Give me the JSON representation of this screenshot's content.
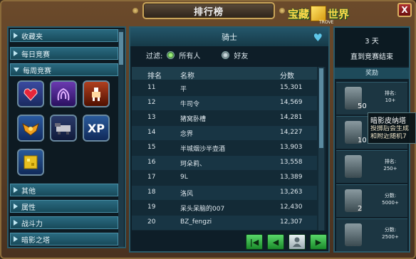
{
  "window": {
    "title": "排行榜",
    "logo_text_left": "宝藏",
    "logo_text_right": "世界",
    "logo_sub": "TROVE",
    "close_label": "X"
  },
  "sidebar": {
    "items": [
      {
        "label": "收藏夹",
        "expanded": false
      },
      {
        "label": "每日竞赛",
        "expanded": false
      },
      {
        "label": "每周竞赛",
        "expanded": true
      },
      {
        "label": "其他",
        "expanded": false
      },
      {
        "label": "属性",
        "expanded": false
      },
      {
        "label": "战斗力",
        "expanded": false
      },
      {
        "label": "暗影之塔",
        "expanded": false
      }
    ],
    "weekly_icons": [
      "heart-gem-icon",
      "tentacle-icon",
      "fighter-icon",
      "wings-badge-icon",
      "mount-icon",
      "xp-icon",
      "block-cube-icon"
    ],
    "xp_label": "XP"
  },
  "board": {
    "header": "骑士",
    "filter_label": "过滤:",
    "filter_all": "所有人",
    "filter_friends": "好友",
    "columns": [
      "排名",
      "名称",
      "分数"
    ],
    "rows": [
      {
        "rank": "11",
        "name": "平",
        "score": "15,301"
      },
      {
        "rank": "12",
        "name": "牛司令",
        "score": "14,569"
      },
      {
        "rank": "13",
        "name": "猪窝卧槽",
        "score": "14,281"
      },
      {
        "rank": "14",
        "name": "念界",
        "score": "14,227"
      },
      {
        "rank": "15",
        "name": "半城烟沙半壶酒",
        "score": "13,903"
      },
      {
        "rank": "16",
        "name": "珂朵莉、",
        "score": "13,558"
      },
      {
        "rank": "17",
        "name": "9L",
        "score": "13,389"
      },
      {
        "rank": "18",
        "name": "洛风",
        "score": "13,263"
      },
      {
        "rank": "19",
        "name": "呆头呆脑的007",
        "score": "12,430"
      },
      {
        "rank": "20",
        "name": "BZ_fengzi",
        "score": "12,307"
      }
    ]
  },
  "contest": {
    "days": "3 天",
    "until": "直到竞赛结束",
    "rewards_header": "奖励",
    "rewards": [
      {
        "qty": "50",
        "line1": "排名:",
        "line2": "10+"
      },
      {
        "qty": "10",
        "line1": "",
        "line2": ""
      },
      {
        "qty": "",
        "line1": "排名:",
        "line2": "250+"
      },
      {
        "qty": "2",
        "line1": "分数:",
        "line2": "5000+"
      },
      {
        "qty": "",
        "line1": "分数:",
        "line2": "2500+"
      }
    ]
  },
  "tooltip": {
    "title": "暗影皮纳塔",
    "line1": "投掷后会生成",
    "line2": "和附近随机7"
  },
  "colors": {
    "accent": "#2a6a80",
    "frame": "#6b4a2b",
    "gold": "#ffd94a",
    "pager_green": "#3ab84a"
  }
}
